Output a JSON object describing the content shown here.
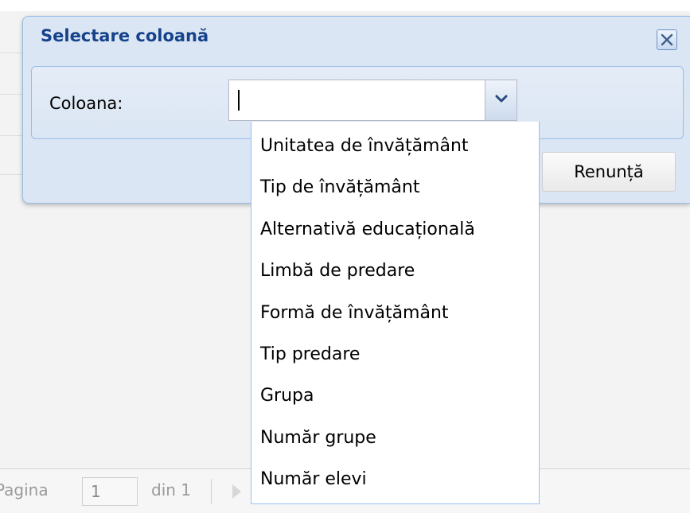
{
  "dialog": {
    "title": "Selectare coloană",
    "field_label": "Coloana:",
    "combo_value": "",
    "cancel_label": "Renunță"
  },
  "dropdown": {
    "options": [
      "Unitatea de învățământ",
      "Tip de învățământ",
      "Alternativă educațională",
      "Limbă de predare",
      "Formă de învățământ",
      "Tip predare",
      "Grupa",
      "Număr grupe",
      "Număr elevi"
    ]
  },
  "pager": {
    "page_label": "Pagina",
    "page_value": "1",
    "of_label": "din 1"
  },
  "colors": {
    "title": "#15428b",
    "dialog_bg": "#dbe6f4",
    "border": "#99bbe8"
  },
  "icons": {
    "close": "close-icon",
    "trigger": "chevron-down-icon",
    "next": "next-page-icon"
  }
}
